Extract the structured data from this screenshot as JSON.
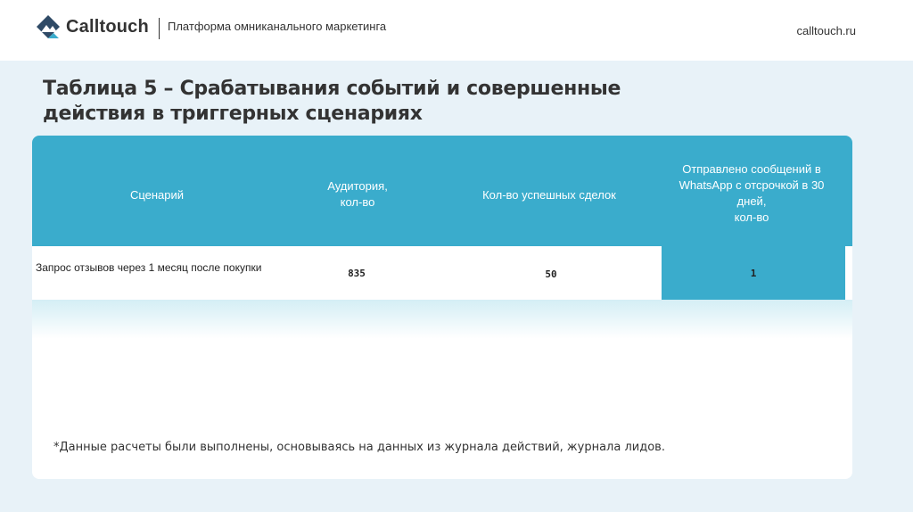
{
  "header": {
    "logo_text": "Calltouch",
    "tagline": "Платформа омниканального маркетинга",
    "site": "calltouch.ru"
  },
  "title": "Таблица 5 – Срабатывания событий и совершенные действия в триггерных сценариях",
  "table": {
    "columns": [
      "Сценарий",
      "Аудитория,\nкол-во",
      "Кол-во успешных сделок",
      "Отправлено сообщений в WhatsApp с отсрочкой в 30 дней,\nкол-во"
    ],
    "rows": [
      {
        "scenario": "Запрос отзывов через 1 месяц после покупки",
        "audience": "835",
        "deals": "50",
        "sent": "1"
      }
    ]
  },
  "footnote": "*Данные расчеты были выполнены, основываясь на данных из журнала действий, журнала лидов.",
  "colors": {
    "accent": "#3aaccc",
    "background": "#e8f2f8"
  }
}
